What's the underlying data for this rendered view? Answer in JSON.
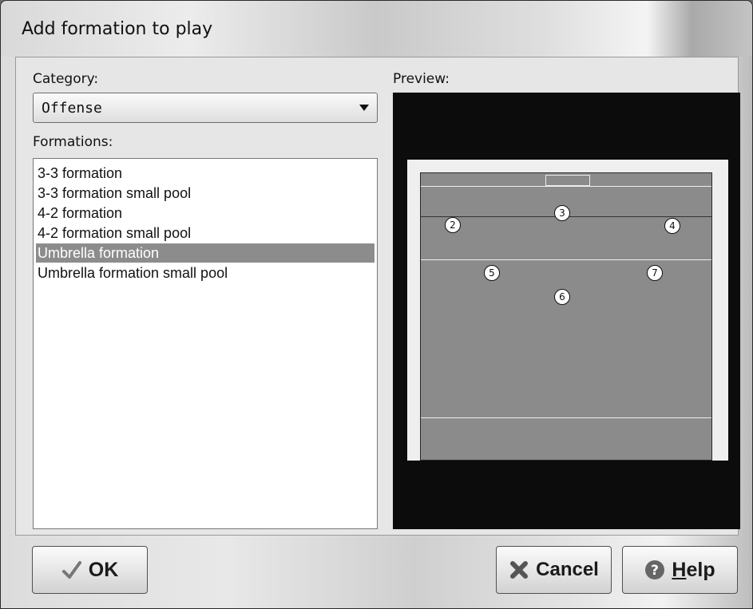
{
  "window": {
    "title": "Add formation to play"
  },
  "category": {
    "label": "Category:",
    "selected": "Offense"
  },
  "formations": {
    "label": "Formations:",
    "items": [
      "3-3 formation",
      "3-3 formation small pool",
      "4-2 formation",
      "4-2 formation small pool",
      "Umbrella formation",
      "Umbrella formation small pool"
    ],
    "selected_index": 4
  },
  "preview": {
    "label": "Preview:",
    "players": [
      "2",
      "3",
      "4",
      "5",
      "7",
      "6"
    ]
  },
  "buttons": {
    "ok": "OK",
    "cancel": "Cancel",
    "help_mnemonic": "H",
    "help_rest": "elp"
  },
  "icons": {
    "ok": "checkmark-icon",
    "cancel": "cancel-x-icon",
    "help": "question-help-icon",
    "dropdown": "chevron-down-icon"
  }
}
